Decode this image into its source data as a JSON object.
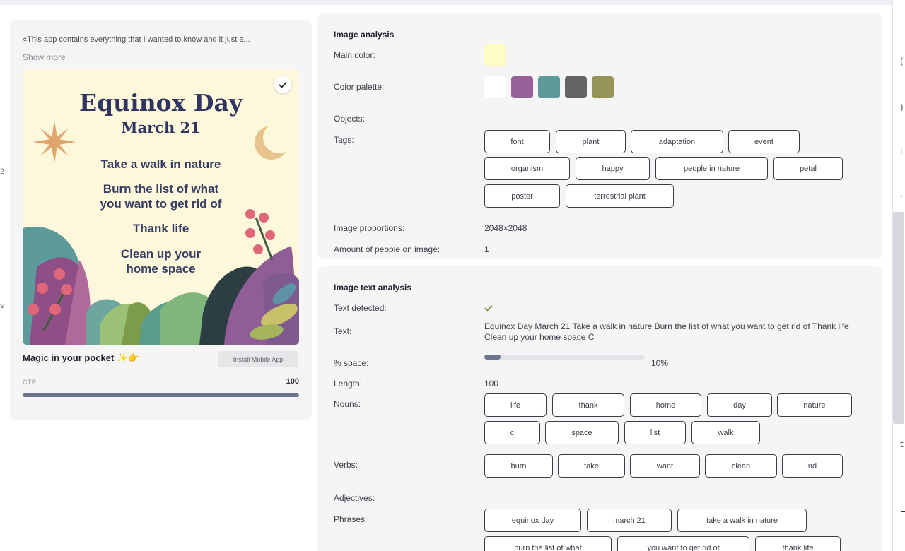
{
  "left_card": {
    "quote": "«This app contains everything that I wanted to know and it just e...",
    "show_more": "Show more",
    "poster": {
      "title": "Equinox Day",
      "date": "March 21",
      "lines": [
        "Take a walk in nature",
        "Burn the list of what",
        "you want to get rid of",
        "Thank life",
        "Clean up your",
        "home space"
      ]
    },
    "caption": "Magic in your pocket ✨👉",
    "install_button": "Install Mobile App",
    "ctr_label": "CTR",
    "ctr_value": "100",
    "ctr_progress": 1.0
  },
  "image_analysis": {
    "title": "Image analysis",
    "main_color_label": "Main color:",
    "main_color": "#fefbc4",
    "palette_label": "Color palette:",
    "palette": [
      "#ffffff",
      "#98609a",
      "#5d9a9b",
      "#636466",
      "#959558"
    ],
    "objects_label": "Objects:",
    "tags_label": "Tags:",
    "tags": [
      "font",
      "plant",
      "adaptation",
      "event",
      "organism",
      "happy",
      "people in nature",
      "petal",
      "poster",
      "terrestrial plant"
    ],
    "proportions_label": "Image proportions:",
    "proportions": "2048×2048",
    "people_label": "Amount of people on image:",
    "people": "1"
  },
  "text_analysis": {
    "title": "Image text analysis",
    "detected_label": "Text detected:",
    "text_label": "Text:",
    "text": "Equinox Day March 21 Take a walk in nature Burn the list of what you want to get rid of Thank life Clean up your home space C",
    "space_label": "% space:",
    "space_value": "10%",
    "space_fraction": 0.1,
    "length_label": "Length:",
    "length": "100",
    "nouns_label": "Nouns:",
    "nouns": [
      "life",
      "thank",
      "home",
      "day",
      "nature",
      "c",
      "space",
      "list",
      "walk"
    ],
    "verbs_label": "Verbs:",
    "verbs": [
      "burn",
      "take",
      "want",
      "clean",
      "rid"
    ],
    "adjectives_label": "Adjectives:",
    "phrases_label": "Phrases:",
    "phrases": [
      "equinox day",
      "march 21",
      "take a walk in nature",
      "burn the list of what",
      "you want to get rid of",
      "thank life"
    ]
  },
  "colors": {
    "accent": "#6b768e",
    "check": "#6b8e3a"
  }
}
